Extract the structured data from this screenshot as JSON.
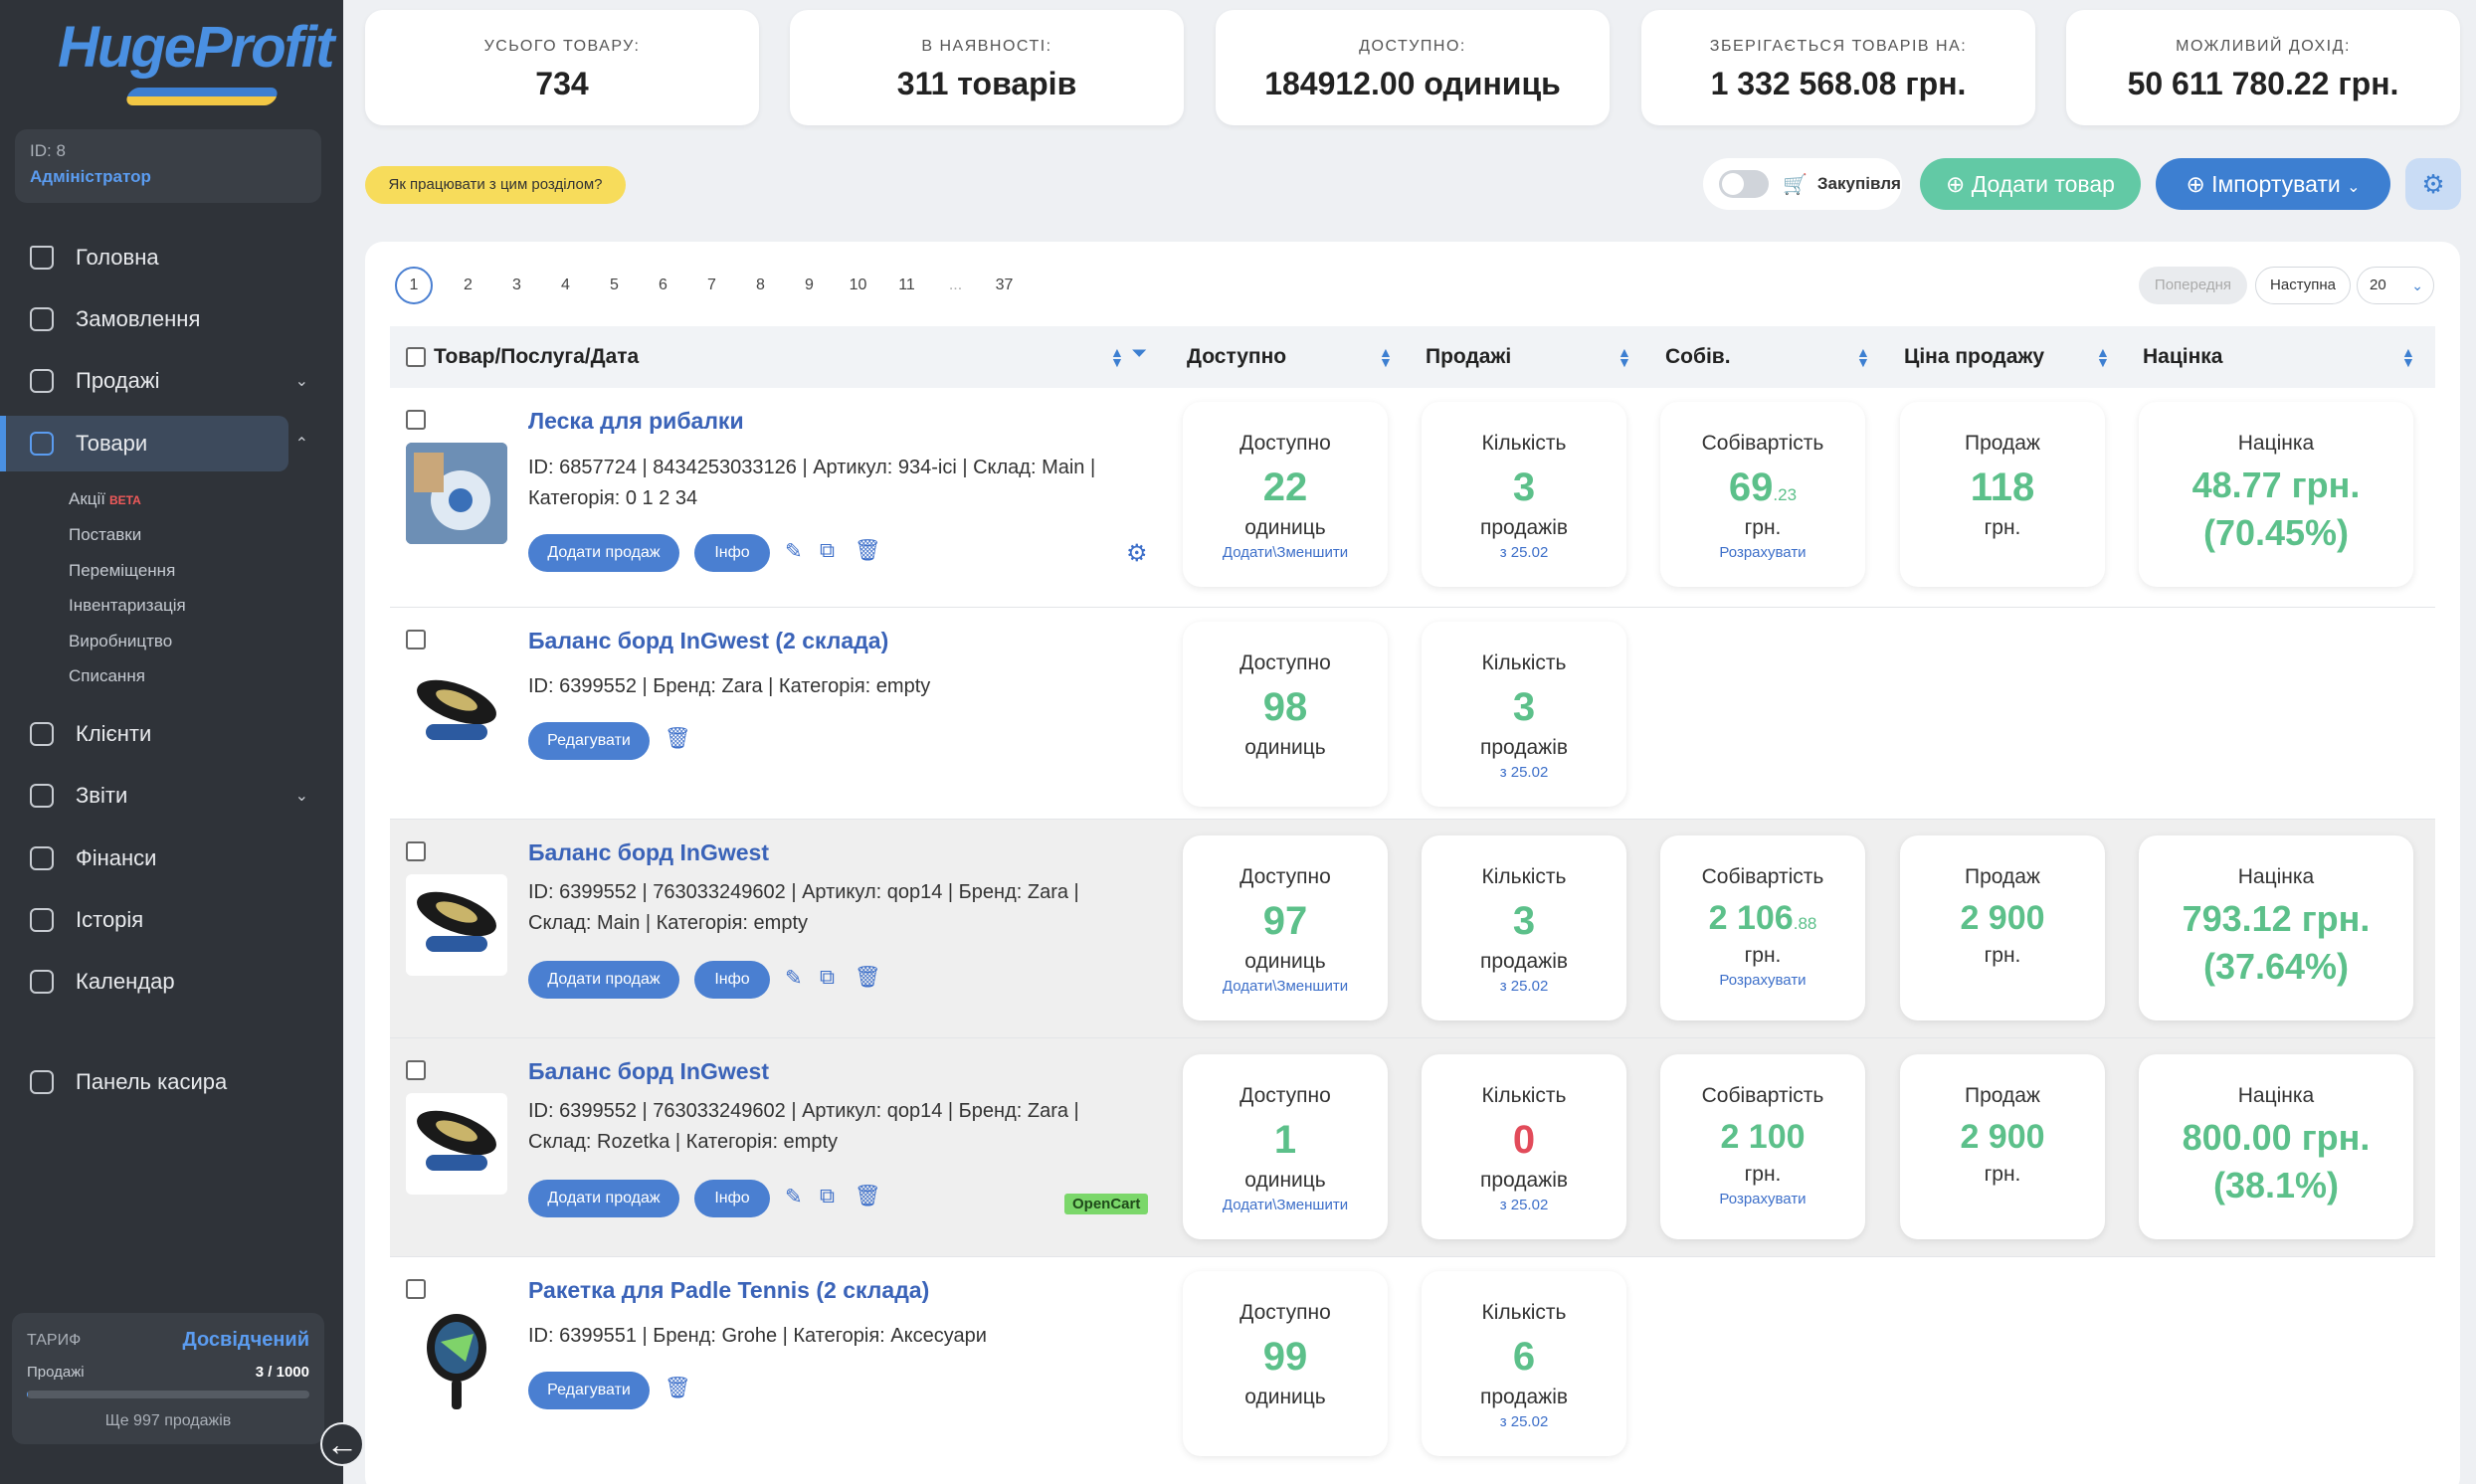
{
  "brand": {
    "name": "HugeProfit"
  },
  "user": {
    "id": "ID: 8",
    "role": "Адміністратор"
  },
  "nav": {
    "home": "Головна",
    "orders": "Замовлення",
    "sales": "Продажі",
    "products": "Товари",
    "clients": "Клієнти",
    "reports": "Звіти",
    "finance": "Фінанси",
    "history": "Історія",
    "calendar": "Календар",
    "cashier": "Панель касира",
    "sub": {
      "promos": "Акції",
      "beta": "BETA",
      "supplies": "Поставки",
      "transfers": "Переміщення",
      "inventory": "Інвентаризація",
      "production": "Виробництво",
      "writeoffs": "Списання"
    }
  },
  "tariff": {
    "label": "ТАРИФ",
    "plan": "Досвідчений",
    "sales_label": "Продажі",
    "sales_count": "3 / 1000",
    "sales_fraction": 0.003,
    "remaining": "Ще 997 продажів"
  },
  "stats": [
    {
      "label": "УСЬОГО ТОВАРУ:",
      "value": "734"
    },
    {
      "label": "В НАЯВНОСТІ:",
      "value": "311 товарів"
    },
    {
      "label": "ДОСТУПНО:",
      "value": "184912.00 одиниць"
    },
    {
      "label": "ЗБЕРІГАЄТЬСЯ ТОВАРІВ НА:",
      "value": "1 332 568.08 грн."
    },
    {
      "label": "МОЖЛИВИЙ ДОХІД:",
      "value": "50 611 780.22 грн."
    }
  ],
  "toolbar": {
    "help": "Як працювати з цим розділом?",
    "purchase": "Закупівля",
    "add_product": "Додати товар",
    "import": "Імпортувати"
  },
  "pagination": {
    "pages": [
      "1",
      "2",
      "3",
      "4",
      "5",
      "6",
      "7",
      "8",
      "9",
      "10",
      "11",
      "...",
      "37"
    ],
    "prev": "Попередня",
    "next": "Наступна",
    "per_page": "20"
  },
  "columns": {
    "product": "Товар/Послуга/Дата",
    "available": "Доступно",
    "sales": "Продажі",
    "cost": "Собів.",
    "price": "Ціна продажу",
    "markup": "Націнка"
  },
  "labels": {
    "available": "Доступно",
    "units": "одиниць",
    "add_reduce": "Додати\\Зменшити",
    "quantity": "Кількість",
    "sales_word": "продажів",
    "since": "з 25.02",
    "cost": "Собівартість",
    "uah": "грн.",
    "calculate": "Розрахувати",
    "sale": "Продаж",
    "markup": "Націнка",
    "add_sale": "Додати продаж",
    "info": "Інфо",
    "edit": "Редагувати"
  },
  "rows": [
    {
      "name": "Леска для рибалки",
      "meta1": "ID: 6857724 | 8434253033126 | Артикул: 934-ісі | Склад: Main |",
      "meta2": "Категорія: 0 1 2 34",
      "available": "22",
      "qty": "3",
      "cost_main": "69",
      "cost_cents": ".23",
      "price": "118",
      "markup1": "48.77 грн.",
      "markup2": "(70.45%)"
    },
    {
      "name": "Баланс борд InGwest (2 склада)",
      "meta1": "ID: 6399552 | Бренд: Zara | Категорія: empty",
      "available": "98",
      "qty": "3"
    },
    {
      "name": "Баланс борд InGwest",
      "meta1": "ID: 6399552 | 763033249602 | Артикул: qop14 | Бренд: Zara |",
      "meta2": "Склад: Main | Категорія: empty",
      "available": "97",
      "qty": "3",
      "cost_main": "2 106",
      "cost_cents": ".88",
      "price": "2 900",
      "markup1": "793.12 грн.",
      "markup2": "(37.64%)"
    },
    {
      "name": "Баланс борд InGwest",
      "meta1": "ID: 6399552 | 763033249602 | Артикул: qop14 | Бренд: Zara |",
      "meta2": "Склад: Rozetka | Категорія: empty",
      "badge": "OpenCart",
      "available": "1",
      "qty": "0",
      "cost_main": "2 100",
      "price": "2 900",
      "markup1": "800.00 грн.",
      "markup2": "(38.1%)"
    },
    {
      "name": "Ракетка для Padle Tennis (2 склада)",
      "meta1": "ID: 6399551 | Бренд: Grohe | Категорія: Аксесуари",
      "available": "99",
      "qty": "6"
    }
  ]
}
